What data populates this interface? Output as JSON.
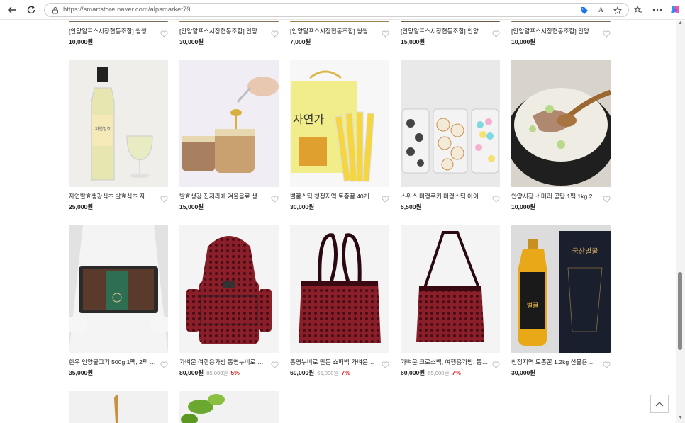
{
  "browser": {
    "url": "https://smartstore.naver.com/alpsmarket79",
    "back_icon": "arrow-left-icon",
    "refresh_icon": "refresh-icon",
    "ai_label": "A"
  },
  "products": {
    "row1": [
      {
        "title": "[안양알프스시장협동조합] 쌍쌍한 ...",
        "price": "10,000원"
      },
      {
        "title": "[안양알프스시장협동조합] 안양 물...",
        "price": "30,000원"
      },
      {
        "title": "[안양알프스시장협동조합] 쌍쌍한 ...",
        "price": "7,000원"
      },
      {
        "title": "[안양알프스시장협동조합] 안양 알...",
        "price": "15,000원"
      },
      {
        "title": "[안양알프스시장협동조합] 안양 물...",
        "price": "10,000원"
      }
    ],
    "row2": [
      {
        "title": "자연발효생강식초 발효식초 자연발...",
        "price": "25,000원"
      },
      {
        "title": "발효생강 진저라떼 겨울음료 생강...",
        "price": "15,000원"
      },
      {
        "title": "벌꿀스틱 청정지역 토종꿀 40개 1...",
        "price": "30,000원"
      },
      {
        "title": "스위스 머랭쿠키 머랭스틱 아이간...",
        "price": "5,500원"
      },
      {
        "title": "안양시장 소머리 곰탕 1팩 1kg 2~3...",
        "price": "10,000원"
      }
    ],
    "row3": [
      {
        "title": "한우 언양불고기 500g 1팩, 2팩 이...",
        "price": "35,000원",
        "orig": "",
        "disc": ""
      },
      {
        "title": "가벼운 여행용가방 통영누비로 만...",
        "price": "80,000원",
        "orig": "85,000원",
        "disc": "5%"
      },
      {
        "title": "통영누비로 만든 쇼퍼백 가벼운가...",
        "price": "60,000원",
        "orig": "65,000원",
        "disc": "7%"
      },
      {
        "title": "가벼운 크로스백, 여행용가방, 통영...",
        "price": "60,000원",
        "orig": "65,000원",
        "disc": "7%"
      },
      {
        "title": "청정지역 토종꿀 1.2kg 선물용 천...",
        "price": "30,000원",
        "orig": "",
        "disc": ""
      }
    ]
  },
  "colors": {
    "discount": "#e02020",
    "original_price": "#999999"
  }
}
